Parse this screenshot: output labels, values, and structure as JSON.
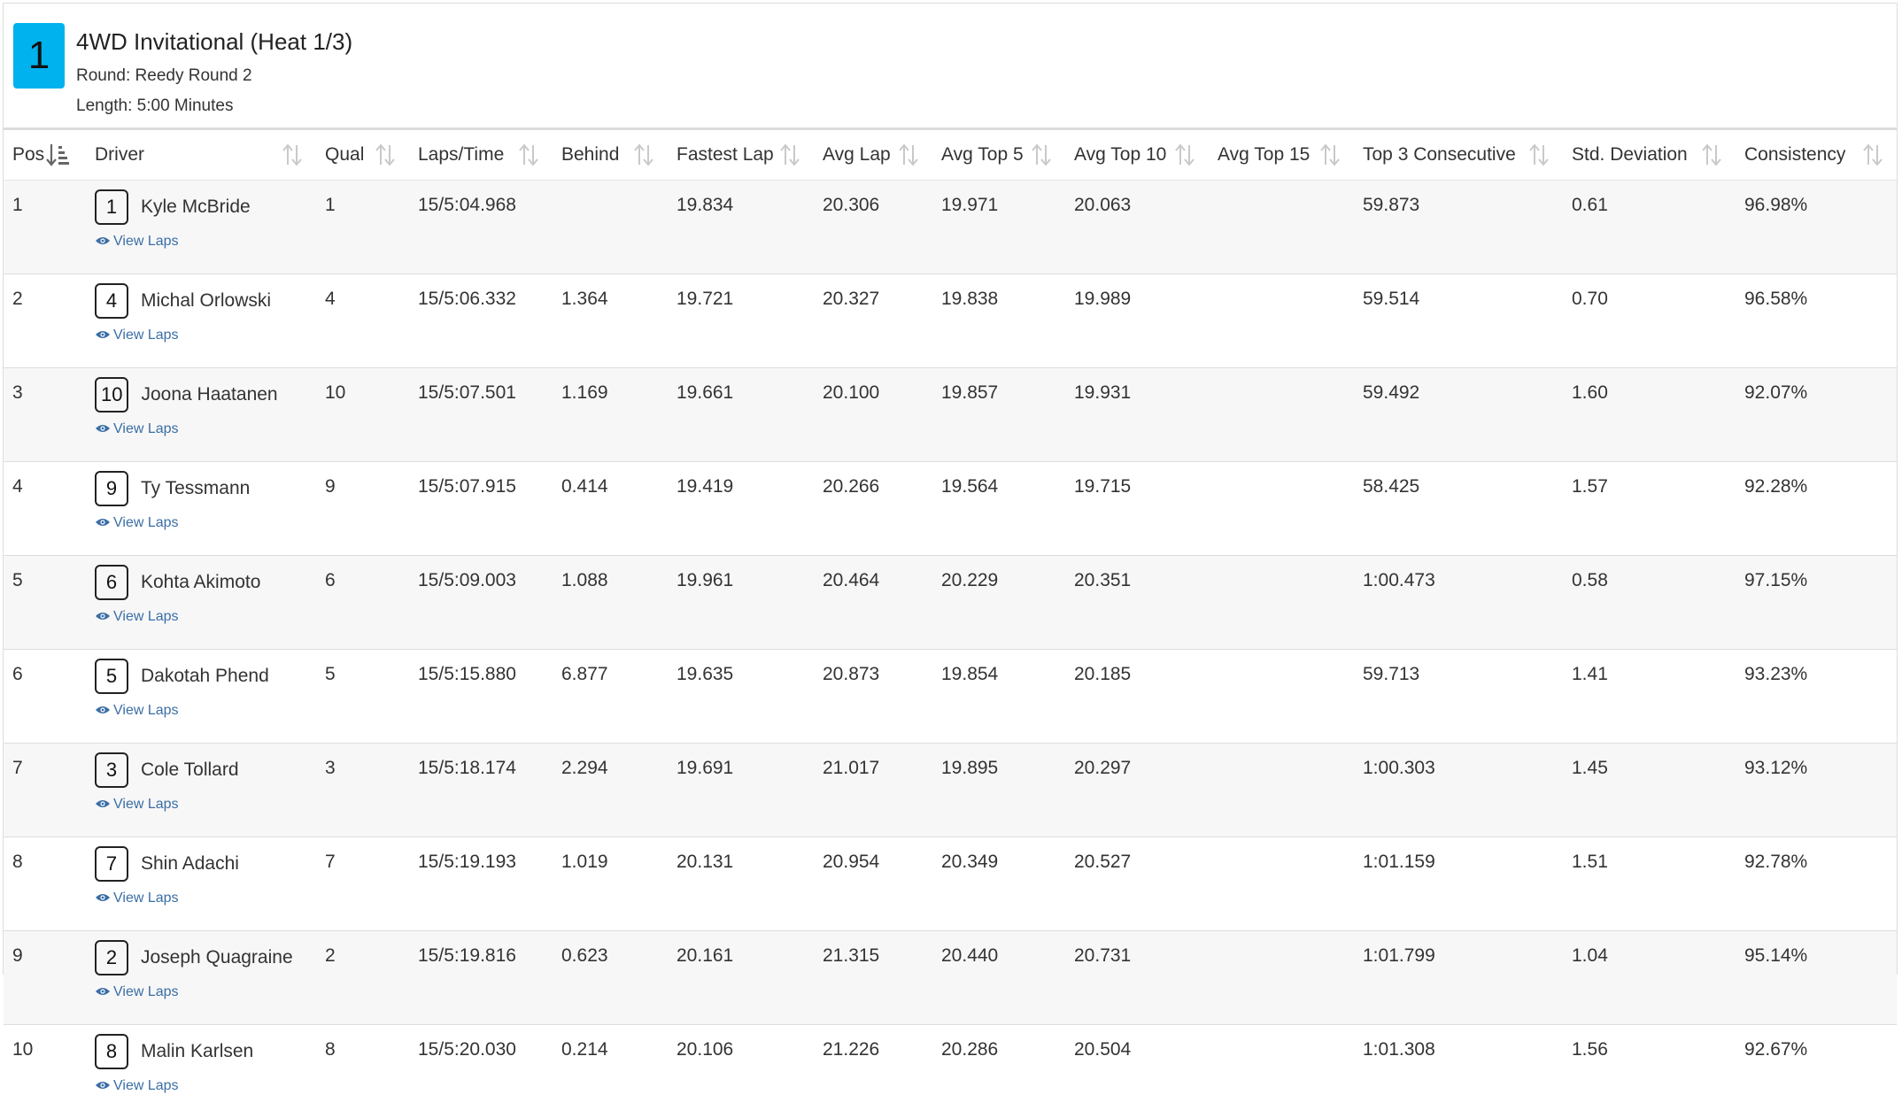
{
  "heat": {
    "number": "1",
    "title": "4WD Invitational (Heat 1/3)",
    "round": "Round: Reedy Round 2",
    "length": "Length: 5:00 Minutes"
  },
  "colors": {
    "badge": "#00b2ee",
    "link": "#3a6ea5",
    "row_stripe": "#f7f7f7"
  },
  "columns": [
    "Pos",
    "Driver",
    "Qual",
    "Laps/Time",
    "Behind",
    "Fastest Lap",
    "Avg Lap",
    "Avg Top 5",
    "Avg Top 10",
    "Avg Top 15",
    "Top 3 Consecutive",
    "Std. Deviation",
    "Consistency"
  ],
  "view_laps_label": "View Laps",
  "rows": [
    {
      "pos": "1",
      "car": "1",
      "driver": "Kyle McBride",
      "qual": "1",
      "laps_time": "15/5:04.968",
      "behind": "",
      "fastest": "19.834",
      "avg": "20.306",
      "top5": "19.971",
      "top10": "20.063",
      "top15": "",
      "top3c": "59.873",
      "std": "0.61",
      "consistency": "96.98%"
    },
    {
      "pos": "2",
      "car": "4",
      "driver": "Michal Orlowski",
      "qual": "4",
      "laps_time": "15/5:06.332",
      "behind": "1.364",
      "fastest": "19.721",
      "avg": "20.327",
      "top5": "19.838",
      "top10": "19.989",
      "top15": "",
      "top3c": "59.514",
      "std": "0.70",
      "consistency": "96.58%"
    },
    {
      "pos": "3",
      "car": "10",
      "driver": "Joona Haatanen",
      "qual": "10",
      "laps_time": "15/5:07.501",
      "behind": "1.169",
      "fastest": "19.661",
      "avg": "20.100",
      "top5": "19.857",
      "top10": "19.931",
      "top15": "",
      "top3c": "59.492",
      "std": "1.60",
      "consistency": "92.07%"
    },
    {
      "pos": "4",
      "car": "9",
      "driver": "Ty Tessmann",
      "qual": "9",
      "laps_time": "15/5:07.915",
      "behind": "0.414",
      "fastest": "19.419",
      "avg": "20.266",
      "top5": "19.564",
      "top10": "19.715",
      "top15": "",
      "top3c": "58.425",
      "std": "1.57",
      "consistency": "92.28%"
    },
    {
      "pos": "5",
      "car": "6",
      "driver": "Kohta Akimoto",
      "qual": "6",
      "laps_time": "15/5:09.003",
      "behind": "1.088",
      "fastest": "19.961",
      "avg": "20.464",
      "top5": "20.229",
      "top10": "20.351",
      "top15": "",
      "top3c": "1:00.473",
      "std": "0.58",
      "consistency": "97.15%"
    },
    {
      "pos": "6",
      "car": "5",
      "driver": "Dakotah Phend",
      "qual": "5",
      "laps_time": "15/5:15.880",
      "behind": "6.877",
      "fastest": "19.635",
      "avg": "20.873",
      "top5": "19.854",
      "top10": "20.185",
      "top15": "",
      "top3c": "59.713",
      "std": "1.41",
      "consistency": "93.23%"
    },
    {
      "pos": "7",
      "car": "3",
      "driver": "Cole Tollard",
      "qual": "3",
      "laps_time": "15/5:18.174",
      "behind": "2.294",
      "fastest": "19.691",
      "avg": "21.017",
      "top5": "19.895",
      "top10": "20.297",
      "top15": "",
      "top3c": "1:00.303",
      "std": "1.45",
      "consistency": "93.12%"
    },
    {
      "pos": "8",
      "car": "7",
      "driver": "Shin Adachi",
      "qual": "7",
      "laps_time": "15/5:19.193",
      "behind": "1.019",
      "fastest": "20.131",
      "avg": "20.954",
      "top5": "20.349",
      "top10": "20.527",
      "top15": "",
      "top3c": "1:01.159",
      "std": "1.51",
      "consistency": "92.78%"
    },
    {
      "pos": "9",
      "car": "2",
      "driver": "Joseph Quagraine",
      "qual": "2",
      "laps_time": "15/5:19.816",
      "behind": "0.623",
      "fastest": "20.161",
      "avg": "21.315",
      "top5": "20.440",
      "top10": "20.731",
      "top15": "",
      "top3c": "1:01.799",
      "std": "1.04",
      "consistency": "95.14%"
    },
    {
      "pos": "10",
      "car": "8",
      "driver": "Malin Karlsen",
      "qual": "8",
      "laps_time": "15/5:20.030",
      "behind": "0.214",
      "fastest": "20.106",
      "avg": "21.226",
      "top5": "20.286",
      "top10": "20.504",
      "top15": "",
      "top3c": "1:01.308",
      "std": "1.56",
      "consistency": "92.67%"
    }
  ]
}
